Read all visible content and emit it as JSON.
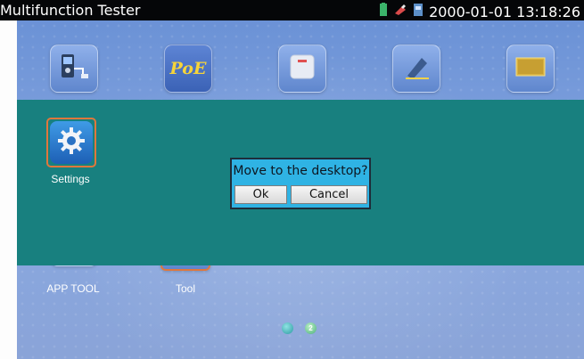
{
  "status_bar": {
    "title": "Multifunction Tester",
    "datetime": "2000-01-01 13:18:26",
    "icons": [
      "battery-icon",
      "usb-icon",
      "network-icon"
    ]
  },
  "desktop": {
    "apps": [
      {
        "icon": "cable-tester-icon"
      },
      {
        "icon": "poe-icon",
        "icon_text": "PoE"
      },
      {
        "icon": "power-outage-icon"
      },
      {
        "icon": "cable-search-icon"
      },
      {
        "icon": "data-icon"
      }
    ],
    "bottom_apps": [
      {
        "label": "APP TOOL"
      },
      {
        "label": "Tool"
      }
    ],
    "page_indicator": {
      "pages": 2,
      "current": 2,
      "current_label": "2"
    }
  },
  "overlay": {
    "app": {
      "label": "Settings",
      "icon": "gear-icon"
    }
  },
  "dialog": {
    "message": "Move to the desktop?",
    "ok_label": "Ok",
    "cancel_label": "Cancel"
  },
  "colors": {
    "overlay": "#18807f",
    "dialog": "#2fb3e4",
    "highlight": "#e0773c"
  }
}
